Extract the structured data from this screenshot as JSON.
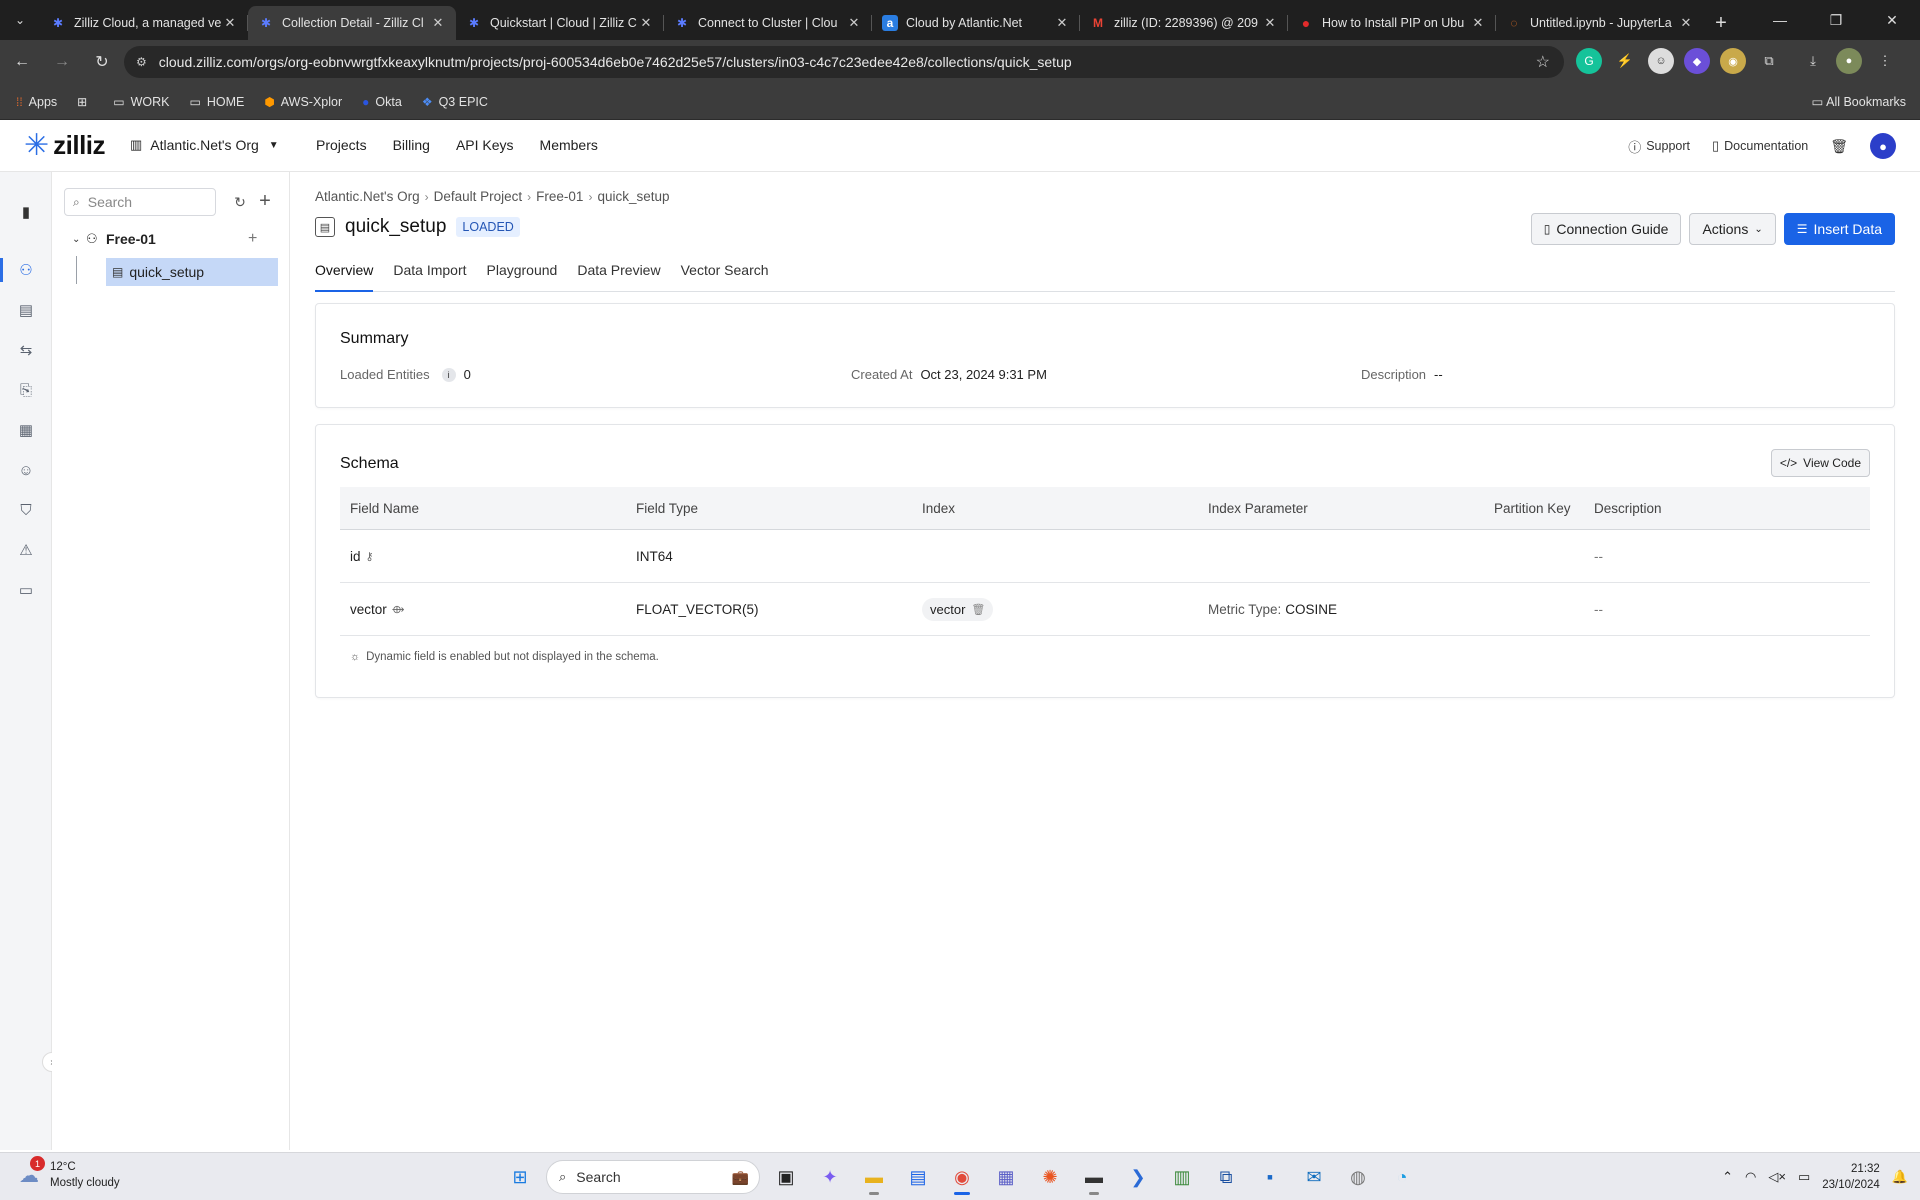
{
  "browser": {
    "tabs": [
      {
        "title": "Zilliz Cloud, a managed ve",
        "favicon": "zilliz-icon",
        "fav_color": "#5b7cff",
        "active": false
      },
      {
        "title": "Collection Detail - Zilliz Cl",
        "favicon": "zilliz-icon",
        "fav_color": "#5b7cff",
        "active": true
      },
      {
        "title": "Quickstart | Cloud | Zilliz C",
        "favicon": "zilliz-icon",
        "fav_color": "#5b7cff",
        "active": false
      },
      {
        "title": "Connect to Cluster | Clou",
        "favicon": "zilliz-icon",
        "fav_color": "#5b7cff",
        "active": false
      },
      {
        "title": "Cloud by Atlantic.Net",
        "favicon": "atlantic-icon",
        "fav_color": "#2a7de1",
        "active": false
      },
      {
        "title": "zilliz (ID: 2289396) @ 209",
        "favicon": "gmail-icon",
        "fav_color": "#ea4335",
        "active": false
      },
      {
        "title": "How to Install PIP on Ubu",
        "favicon": "opera-icon",
        "fav_color": "#e22b2b",
        "active": false
      },
      {
        "title": "Untitled.ipynb - JupyterLa",
        "favicon": "jupyter-icon",
        "fav_color": "#f37726",
        "active": false
      }
    ],
    "url": "cloud.zilliz.com/orgs/org-eobnvwrgtfxkeaxylknutm/projects/proj-600534d6eb0e7462d25e57/clusters/in03-c4c7c23edee42e8/collections/quick_setup",
    "bookmarks": [
      {
        "label": "Apps",
        "icon": "apps-grid-icon"
      },
      {
        "label": "",
        "icon": "grid-icon"
      },
      {
        "label": "WORK",
        "icon": "folder-icon"
      },
      {
        "label": "HOME",
        "icon": "folder-icon"
      },
      {
        "label": "AWS-Xplor",
        "icon": "aws-icon"
      },
      {
        "label": "Okta",
        "icon": "okta-icon"
      },
      {
        "label": "Q3 EPIC",
        "icon": "jira-icon"
      }
    ],
    "all_bookmarks": "All Bookmarks"
  },
  "app": {
    "brand": "zilliz",
    "org": "Atlantic.Net's Org",
    "nav": [
      "Projects",
      "Billing",
      "API Keys",
      "Members"
    ],
    "support": "Support",
    "documentation": "Documentation"
  },
  "sidebar": {
    "search_placeholder": "Search",
    "cluster": "Free-01",
    "collection": "quick_setup"
  },
  "page": {
    "breadcrumb": [
      "Atlantic.Net's Org",
      "Default Project",
      "Free-01",
      "quick_setup"
    ],
    "title": "quick_setup",
    "status": "LOADED",
    "buttons": {
      "connection_guide": "Connection Guide",
      "actions": "Actions",
      "insert_data": "Insert Data"
    },
    "tabs": [
      "Overview",
      "Data Import",
      "Playground",
      "Data Preview",
      "Vector Search"
    ],
    "active_tab": "Overview"
  },
  "summary": {
    "heading": "Summary",
    "loaded_entities_label": "Loaded Entities",
    "loaded_entities_value": "0",
    "created_at_label": "Created At",
    "created_at_value": "Oct 23, 2024 9:31 PM",
    "description_label": "Description",
    "description_value": "--"
  },
  "schema": {
    "heading": "Schema",
    "view_code": "View Code",
    "columns": [
      "Field Name",
      "Field Type",
      "Index",
      "Index Parameter",
      "Partition Key",
      "Description"
    ],
    "rows": [
      {
        "field": "id",
        "type": "INT64",
        "index": "",
        "param_label": "",
        "param_value": "",
        "partition": "",
        "description": "--"
      },
      {
        "field": "vector",
        "type": "FLOAT_VECTOR(5)",
        "index": "vector",
        "param_label": "Metric Type:",
        "param_value": "COSINE",
        "partition": "",
        "description": "--"
      }
    ],
    "note": "Dynamic field is enabled but not displayed in the schema."
  },
  "taskbar": {
    "temperature": "12°C",
    "weather": "Mostly cloudy",
    "weather_badge": "1",
    "search": "Search",
    "time": "21:32",
    "date": "23/10/2024"
  },
  "colors": {
    "accent": "#1a63e6",
    "selected_tree": "#c5d8f7",
    "loaded_badge": "#e5efff"
  }
}
